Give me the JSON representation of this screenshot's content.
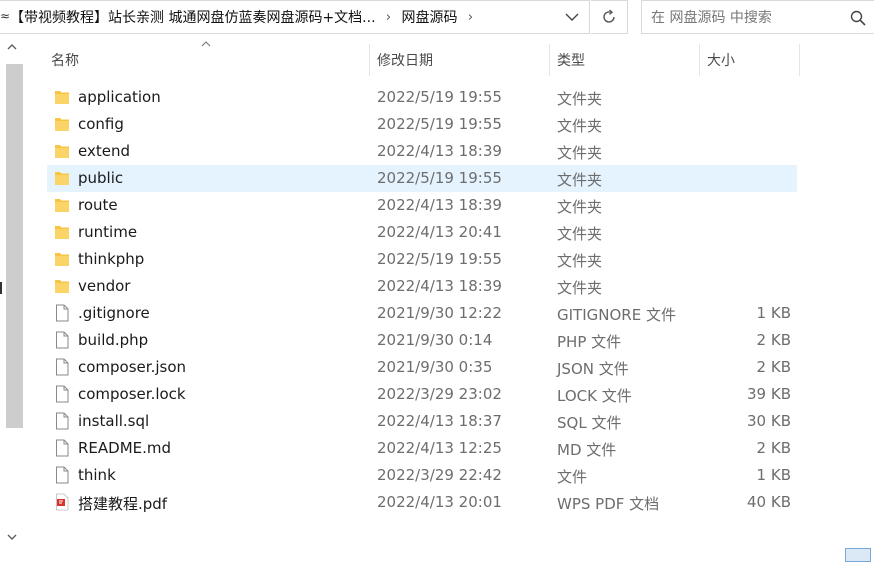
{
  "address": {
    "breadcrumbs": [
      "【带视频教程】站长亲测 城通网盘仿蓝奏网盘源码+文档...",
      "网盘源码"
    ],
    "separator": "›"
  },
  "search": {
    "placeholder": "在 网盘源码 中搜索"
  },
  "columns": {
    "name": "名称",
    "date": "修改日期",
    "type": "类型",
    "size": "大小"
  },
  "files": [
    {
      "name": "application",
      "date": "2022/5/19 19:55",
      "type": "文件夹",
      "size": "",
      "icon": "folder-icon"
    },
    {
      "name": "config",
      "date": "2022/5/19 19:55",
      "type": "文件夹",
      "size": "",
      "icon": "folder-icon"
    },
    {
      "name": "extend",
      "date": "2022/4/13 18:39",
      "type": "文件夹",
      "size": "",
      "icon": "folder-icon"
    },
    {
      "name": "public",
      "date": "2022/5/19 19:55",
      "type": "文件夹",
      "size": "",
      "icon": "folder-icon",
      "selected": true
    },
    {
      "name": "route",
      "date": "2022/4/13 18:39",
      "type": "文件夹",
      "size": "",
      "icon": "folder-icon"
    },
    {
      "name": "runtime",
      "date": "2022/4/13 20:41",
      "type": "文件夹",
      "size": "",
      "icon": "folder-icon"
    },
    {
      "name": "thinkphp",
      "date": "2022/5/19 19:55",
      "type": "文件夹",
      "size": "",
      "icon": "folder-icon"
    },
    {
      "name": "vendor",
      "date": "2022/4/13 18:39",
      "type": "文件夹",
      "size": "",
      "icon": "folder-icon"
    },
    {
      "name": ".gitignore",
      "date": "2021/9/30 12:22",
      "type": "GITIGNORE 文件",
      "size": "1 KB",
      "icon": "file-icon"
    },
    {
      "name": "build.php",
      "date": "2021/9/30 0:14",
      "type": "PHP 文件",
      "size": "2 KB",
      "icon": "file-icon"
    },
    {
      "name": "composer.json",
      "date": "2021/9/30 0:35",
      "type": "JSON 文件",
      "size": "2 KB",
      "icon": "file-icon"
    },
    {
      "name": "composer.lock",
      "date": "2022/3/29 23:02",
      "type": "LOCK 文件",
      "size": "39 KB",
      "icon": "file-icon"
    },
    {
      "name": "install.sql",
      "date": "2022/4/13 18:37",
      "type": "SQL 文件",
      "size": "30 KB",
      "icon": "file-icon"
    },
    {
      "name": "README.md",
      "date": "2022/4/13 12:25",
      "type": "MD 文件",
      "size": "2 KB",
      "icon": "file-icon"
    },
    {
      "name": "think",
      "date": "2022/3/29 22:42",
      "type": "文件",
      "size": "1 KB",
      "icon": "file-icon"
    },
    {
      "name": "搭建教程.pdf",
      "date": "2022/4/13 20:01",
      "type": "WPS PDF 文档",
      "size": "40 KB",
      "icon": "pdf-icon"
    }
  ],
  "colors": {
    "selected_row": "#e5f3ff",
    "folder": "#f8c443",
    "pdf_accent": "#d9342b"
  }
}
